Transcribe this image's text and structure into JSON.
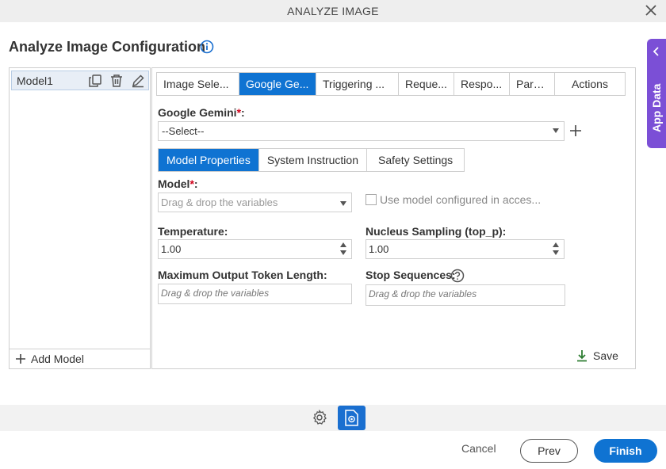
{
  "window": {
    "title": "ANALYZE IMAGE",
    "close_icon": "close-icon"
  },
  "page": {
    "heading": "Analyze Image Configuration",
    "info_icon": "info-icon"
  },
  "models": {
    "items": [
      {
        "label": "Model1"
      }
    ],
    "add_label": "Add Model"
  },
  "tabs": [
    {
      "label": "Image Sele...",
      "active": false
    },
    {
      "label": "Google Ge...",
      "active": true
    },
    {
      "label": "Triggering ...",
      "active": false
    },
    {
      "label": "Reque...",
      "active": false
    },
    {
      "label": "Respo...",
      "active": false
    },
    {
      "label": "Pars...",
      "active": false
    },
    {
      "label": "Actions",
      "active": false
    }
  ],
  "gemini": {
    "label": "Google Gemini",
    "required_mark": "*",
    "label_suffix": ":",
    "value": "--Select--"
  },
  "subtabs": [
    {
      "label": "Model Properties",
      "active": true
    },
    {
      "label": "System Instruction",
      "active": false
    },
    {
      "label": "Safety Settings",
      "active": false
    }
  ],
  "form": {
    "model_label": "Model",
    "model_required": "*",
    "model_suffix": ":",
    "model_placeholder": "Drag & drop the variables",
    "use_model_checkbox": "Use model configured in acces...",
    "use_model_checked": false,
    "temperature_label": "Temperature:",
    "temperature_value": "1.00",
    "top_p_label": "Nucleus Sampling (top_p):",
    "top_p_value": "1.00",
    "max_tokens_label": "Maximum Output Token Length:",
    "max_tokens_placeholder": "Drag & drop the variables",
    "stop_sequences_label": "Stop Sequences:",
    "stop_sequences_placeholder": "Drag & drop the variables"
  },
  "save_label": "Save",
  "side_panel": {
    "label": "App Data"
  },
  "footer": {
    "cancel": "Cancel",
    "prev": "Prev",
    "finish": "Finish"
  },
  "colors": {
    "accent": "#0f73d2",
    "app_data": "#7b4fd6",
    "required": "#d0021b",
    "save_icon": "#2e7d32"
  }
}
